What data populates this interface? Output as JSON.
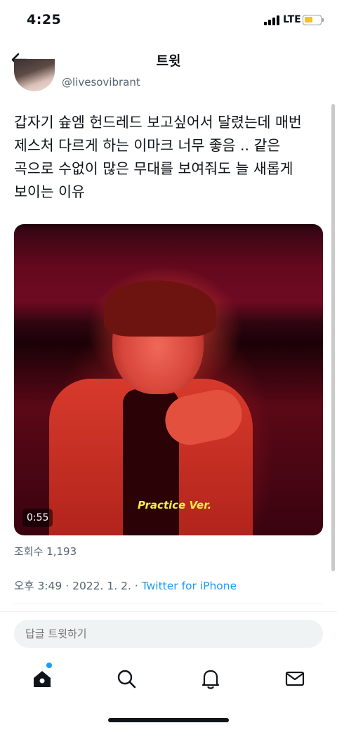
{
  "status_bar": {
    "time": "4:25",
    "network": "LTE"
  },
  "header": {
    "title": "트윗"
  },
  "tweet": {
    "handle": "@livesovibrant",
    "text": "갑자기 슢엠 헌드레드 보고싶어서 달렸는데 매번 제스처 다르게 하는 이마크 너무 좋음 .. 같은 곡으로 수없이 많은 무대를 보여줘도 늘 새롭게 보이는 이유",
    "video": {
      "caption": "Practice Ver.",
      "duration": "0:55"
    },
    "views": "조회수 1,193",
    "time": "오후 3:49",
    "date": "2022. 1. 2.",
    "separator": "·",
    "source": "Twitter for iPhone"
  },
  "reply": {
    "placeholder": "답글 트윗하기"
  },
  "tab_bar": {
    "items": [
      {
        "name": "home-icon",
        "active": true
      },
      {
        "name": "search-icon",
        "active": false
      },
      {
        "name": "bell-icon",
        "active": false
      },
      {
        "name": "mail-icon",
        "active": false
      }
    ]
  },
  "colors": {
    "accent": "#1d9bf0",
    "text": "#0f1419",
    "secondary": "#536471",
    "caption": "#f5ec4a"
  }
}
